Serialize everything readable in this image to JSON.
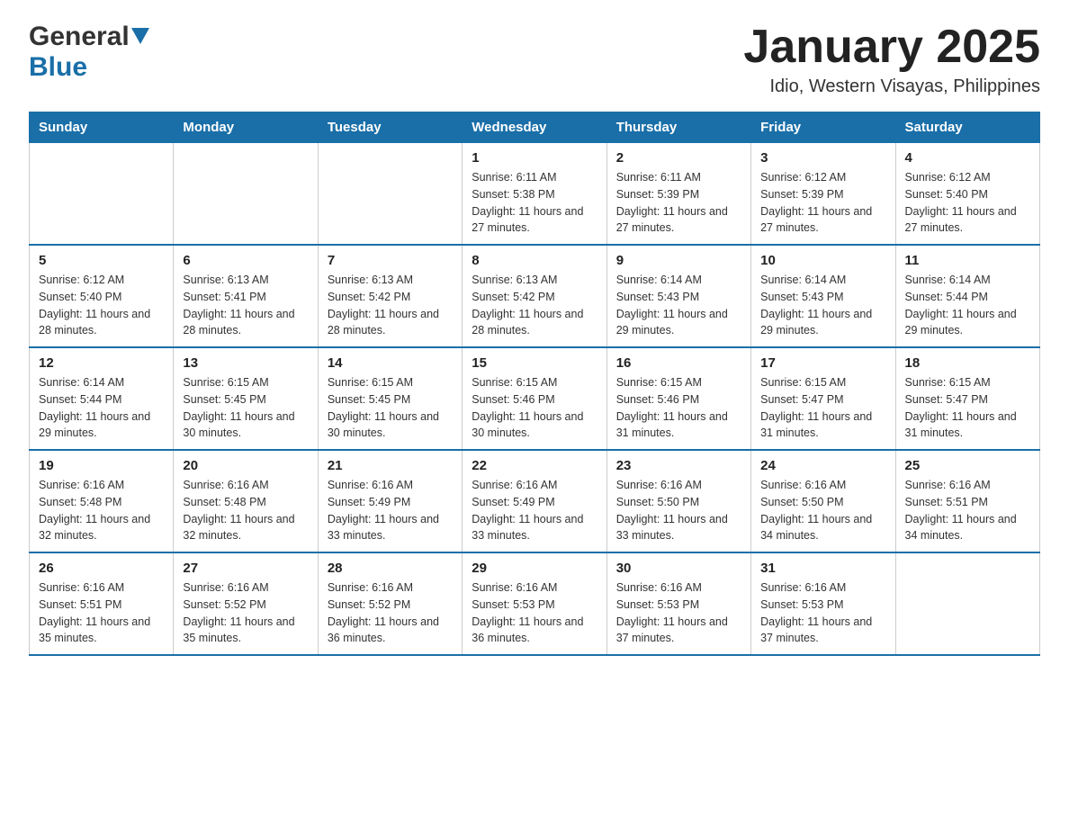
{
  "header": {
    "logo_general": "General",
    "logo_blue": "Blue",
    "month_title": "January 2025",
    "location": "Idio, Western Visayas, Philippines"
  },
  "days_of_week": [
    "Sunday",
    "Monday",
    "Tuesday",
    "Wednesday",
    "Thursday",
    "Friday",
    "Saturday"
  ],
  "weeks": [
    [
      {
        "day": "",
        "info": ""
      },
      {
        "day": "",
        "info": ""
      },
      {
        "day": "",
        "info": ""
      },
      {
        "day": "1",
        "info": "Sunrise: 6:11 AM\nSunset: 5:38 PM\nDaylight: 11 hours and 27 minutes."
      },
      {
        "day": "2",
        "info": "Sunrise: 6:11 AM\nSunset: 5:39 PM\nDaylight: 11 hours and 27 minutes."
      },
      {
        "day": "3",
        "info": "Sunrise: 6:12 AM\nSunset: 5:39 PM\nDaylight: 11 hours and 27 minutes."
      },
      {
        "day": "4",
        "info": "Sunrise: 6:12 AM\nSunset: 5:40 PM\nDaylight: 11 hours and 27 minutes."
      }
    ],
    [
      {
        "day": "5",
        "info": "Sunrise: 6:12 AM\nSunset: 5:40 PM\nDaylight: 11 hours and 28 minutes."
      },
      {
        "day": "6",
        "info": "Sunrise: 6:13 AM\nSunset: 5:41 PM\nDaylight: 11 hours and 28 minutes."
      },
      {
        "day": "7",
        "info": "Sunrise: 6:13 AM\nSunset: 5:42 PM\nDaylight: 11 hours and 28 minutes."
      },
      {
        "day": "8",
        "info": "Sunrise: 6:13 AM\nSunset: 5:42 PM\nDaylight: 11 hours and 28 minutes."
      },
      {
        "day": "9",
        "info": "Sunrise: 6:14 AM\nSunset: 5:43 PM\nDaylight: 11 hours and 29 minutes."
      },
      {
        "day": "10",
        "info": "Sunrise: 6:14 AM\nSunset: 5:43 PM\nDaylight: 11 hours and 29 minutes."
      },
      {
        "day": "11",
        "info": "Sunrise: 6:14 AM\nSunset: 5:44 PM\nDaylight: 11 hours and 29 minutes."
      }
    ],
    [
      {
        "day": "12",
        "info": "Sunrise: 6:14 AM\nSunset: 5:44 PM\nDaylight: 11 hours and 29 minutes."
      },
      {
        "day": "13",
        "info": "Sunrise: 6:15 AM\nSunset: 5:45 PM\nDaylight: 11 hours and 30 minutes."
      },
      {
        "day": "14",
        "info": "Sunrise: 6:15 AM\nSunset: 5:45 PM\nDaylight: 11 hours and 30 minutes."
      },
      {
        "day": "15",
        "info": "Sunrise: 6:15 AM\nSunset: 5:46 PM\nDaylight: 11 hours and 30 minutes."
      },
      {
        "day": "16",
        "info": "Sunrise: 6:15 AM\nSunset: 5:46 PM\nDaylight: 11 hours and 31 minutes."
      },
      {
        "day": "17",
        "info": "Sunrise: 6:15 AM\nSunset: 5:47 PM\nDaylight: 11 hours and 31 minutes."
      },
      {
        "day": "18",
        "info": "Sunrise: 6:15 AM\nSunset: 5:47 PM\nDaylight: 11 hours and 31 minutes."
      }
    ],
    [
      {
        "day": "19",
        "info": "Sunrise: 6:16 AM\nSunset: 5:48 PM\nDaylight: 11 hours and 32 minutes."
      },
      {
        "day": "20",
        "info": "Sunrise: 6:16 AM\nSunset: 5:48 PM\nDaylight: 11 hours and 32 minutes."
      },
      {
        "day": "21",
        "info": "Sunrise: 6:16 AM\nSunset: 5:49 PM\nDaylight: 11 hours and 33 minutes."
      },
      {
        "day": "22",
        "info": "Sunrise: 6:16 AM\nSunset: 5:49 PM\nDaylight: 11 hours and 33 minutes."
      },
      {
        "day": "23",
        "info": "Sunrise: 6:16 AM\nSunset: 5:50 PM\nDaylight: 11 hours and 33 minutes."
      },
      {
        "day": "24",
        "info": "Sunrise: 6:16 AM\nSunset: 5:50 PM\nDaylight: 11 hours and 34 minutes."
      },
      {
        "day": "25",
        "info": "Sunrise: 6:16 AM\nSunset: 5:51 PM\nDaylight: 11 hours and 34 minutes."
      }
    ],
    [
      {
        "day": "26",
        "info": "Sunrise: 6:16 AM\nSunset: 5:51 PM\nDaylight: 11 hours and 35 minutes."
      },
      {
        "day": "27",
        "info": "Sunrise: 6:16 AM\nSunset: 5:52 PM\nDaylight: 11 hours and 35 minutes."
      },
      {
        "day": "28",
        "info": "Sunrise: 6:16 AM\nSunset: 5:52 PM\nDaylight: 11 hours and 36 minutes."
      },
      {
        "day": "29",
        "info": "Sunrise: 6:16 AM\nSunset: 5:53 PM\nDaylight: 11 hours and 36 minutes."
      },
      {
        "day": "30",
        "info": "Sunrise: 6:16 AM\nSunset: 5:53 PM\nDaylight: 11 hours and 37 minutes."
      },
      {
        "day": "31",
        "info": "Sunrise: 6:16 AM\nSunset: 5:53 PM\nDaylight: 11 hours and 37 minutes."
      },
      {
        "day": "",
        "info": ""
      }
    ]
  ]
}
